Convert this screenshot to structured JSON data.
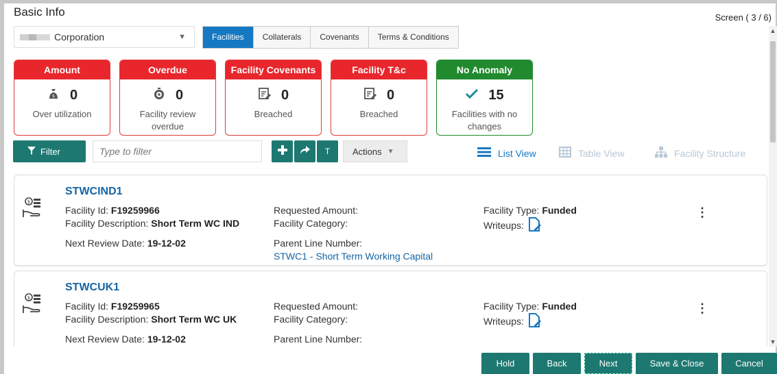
{
  "header": {
    "title": "Basic Info",
    "screen": "Screen ( 3 / 6)"
  },
  "party_select": {
    "value": "Corporation"
  },
  "tabs": [
    {
      "label": "Facilities",
      "active": true
    },
    {
      "label": "Collaterals",
      "active": false
    },
    {
      "label": "Covenants",
      "active": false
    },
    {
      "label": "Terms & Conditions",
      "active": false
    }
  ],
  "summary_cards": [
    {
      "head": "Amount",
      "count": "0",
      "sub": "Over utilization",
      "icon": "money-bag-icon",
      "color": "#e8262c"
    },
    {
      "head": "Overdue",
      "count": "0",
      "sub": "Facility review overdue",
      "icon": "stopwatch-icon",
      "color": "#e8262c"
    },
    {
      "head": "Facility Covenants",
      "count": "0",
      "sub": "Breached",
      "icon": "document-edit-icon",
      "color": "#e8262c"
    },
    {
      "head": "Facility T&c",
      "count": "0",
      "sub": "Breached",
      "icon": "document-edit-icon",
      "color": "#e8262c"
    },
    {
      "head": "No Anomaly",
      "count": "15",
      "sub": "Facilities with no changes",
      "icon": "check-icon",
      "color": "#218a2f"
    }
  ],
  "toolbar": {
    "filter_label": "Filter",
    "filter_placeholder": "Type to filter",
    "t_label": "T",
    "actions_label": "Actions"
  },
  "views": {
    "list": "List View",
    "table": "Table View",
    "structure": "Facility Structure"
  },
  "facilities": [
    {
      "name": "STWCIND1",
      "facility_id_label": "Facility Id:",
      "facility_id": "F19259966",
      "desc_label": "Facility Description:",
      "desc": "Short Term WC IND",
      "review_label": "Next Review Date:",
      "review": "19-12-02",
      "req_amount_label": "Requested Amount:",
      "category_label": "Facility Category:",
      "parent_label": "Parent Line Number:",
      "parent": "STWC1 - Short Term Working Capital",
      "type_label": "Facility Type:",
      "type": "Funded",
      "writeups_label": "Writeups:"
    },
    {
      "name": "STWCUK1",
      "facility_id_label": "Facility Id:",
      "facility_id": "F19259965",
      "desc_label": "Facility Description:",
      "desc": "Short Term WC UK",
      "review_label": "Next Review Date:",
      "review": "19-12-02",
      "req_amount_label": "Requested Amount:",
      "category_label": "Facility Category:",
      "parent_label": "Parent Line Number:",
      "parent": "",
      "type_label": "Facility Type:",
      "type": "Funded",
      "writeups_label": "Writeups:"
    }
  ],
  "footer": {
    "hold": "Hold",
    "back": "Back",
    "next": "Next",
    "save_close": "Save & Close",
    "cancel": "Cancel"
  },
  "colors": {
    "primary": "#1d7871",
    "tab_active": "#1578c2",
    "alert": "#e8262c",
    "ok": "#218a2f",
    "link": "#1565a6"
  }
}
